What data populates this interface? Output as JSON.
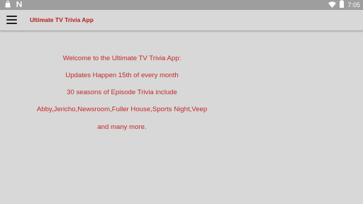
{
  "status_bar": {
    "time": "7:05",
    "icons": [
      "bag-icon",
      "n-notification-icon",
      "wifi-icon",
      "battery-icon"
    ]
  },
  "app_bar": {
    "menu_icon": "hamburger-menu-icon",
    "title": "Ultimate TV Trivia App"
  },
  "content": {
    "lines": [
      "Welcome to the Ultimate TV Trivia App:",
      "Updates Happen 15th of every month",
      "30 seasons of Episode Trivia include",
      "Abby,Jericho,Newsroom,Fuller House,Sports Night,Veep",
      "and many more."
    ]
  },
  "colors": {
    "status_bar": "#9e9e9e",
    "background": "#d8d8d8",
    "accent_text": "#c62828"
  }
}
